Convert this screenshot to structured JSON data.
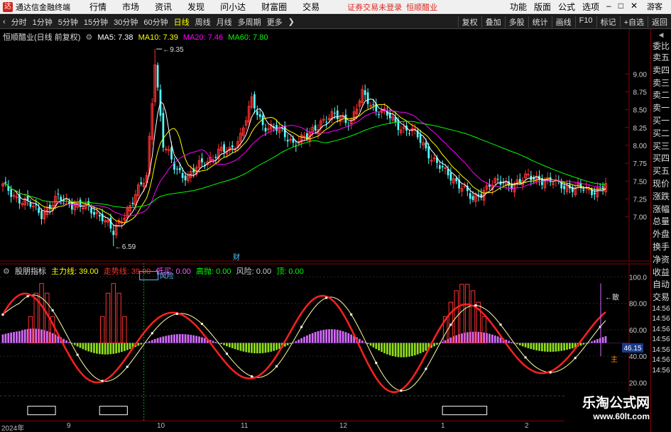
{
  "app": {
    "title": "通达信金融终端",
    "menu": [
      "行情",
      "市场",
      "资讯",
      "发现",
      "问小达",
      "财富圈",
      "交易"
    ],
    "notice": "证券交易未登录",
    "stock_name": "恒顺醋业",
    "right_menu": [
      "功能",
      "版面",
      "公式",
      "选项"
    ],
    "guest": "游客",
    "logo_glyph": "达"
  },
  "toolbar": {
    "periods": [
      "分时",
      "1分钟",
      "5分钟",
      "15分钟",
      "30分钟",
      "60分钟",
      "日线",
      "周线",
      "月线",
      "多周期",
      "更多"
    ],
    "active_period": "日线",
    "right_buttons": [
      "复权",
      "叠加",
      "多股",
      "统计",
      "画线",
      "F10",
      "标记",
      "+自选",
      "返回"
    ]
  },
  "main_chart": {
    "header_title": "恒顺醋业(日线 前复权)",
    "ma": [
      {
        "label": "MA5: 7.38",
        "color": "#ffffff"
      },
      {
        "label": "MA10: 7.39",
        "color": "#ffff00"
      },
      {
        "label": "MA20: 7.46",
        "color": "#ff00ff"
      },
      {
        "label": "MA60: 7.80",
        "color": "#00ff00"
      }
    ],
    "y_ticks": [
      "9.00",
      "8.75",
      "8.50",
      "8.25",
      "8.00",
      "7.75",
      "7.50",
      "7.25",
      "7.00"
    ],
    "high_label": "9.35",
    "low_label": "6.59",
    "event_label": "财"
  },
  "indicator": {
    "name": "股朋指标",
    "values": [
      {
        "label": "主力线: 39.00",
        "color": "#ffff00"
      },
      {
        "label": "走势线: 39.00",
        "color": "#ff3030"
      },
      {
        "label": "低买: 0.00",
        "color": "#ff55ff"
      },
      {
        "label": "高抛: 0.00",
        "color": "#00ff00"
      },
      {
        "label": "风险: 0.00",
        "color": "#cccccc"
      },
      {
        "label": "顶: 0.00",
        "color": "#00ff00"
      }
    ],
    "y_ticks": [
      "100.0",
      "80.00",
      "60.00",
      "40.00",
      "20.00"
    ],
    "risk_label": "风险",
    "dispel_label": "散",
    "main_label": "主",
    "current_value": "46.15"
  },
  "right_panel": {
    "top": "委比",
    "items": [
      "卖五",
      "卖四",
      "卖三",
      "卖二",
      "卖一",
      "买一",
      "买二",
      "买三",
      "买四",
      "买五",
      "现价",
      "涨跌",
      "涨幅",
      "总量",
      "外盘",
      "换手",
      "净资",
      "收益",
      "自动",
      "交易"
    ],
    "times": [
      "14:56",
      "14:56",
      "14:56",
      "14:56",
      "14:56",
      "14:56",
      "14:56"
    ]
  },
  "date_axis": [
    "2024年",
    "9",
    "10",
    "11",
    "12",
    "1",
    "2"
  ],
  "watermark": {
    "line1": "乐淘公式网",
    "line2": "www.60lt.com"
  },
  "colors": {
    "up": "#ff3232",
    "down": "#54ffff",
    "ma5": "#ffffff",
    "ma10": "#ffff00",
    "ma20": "#ff00ff",
    "ma60": "#00ff00"
  }
}
